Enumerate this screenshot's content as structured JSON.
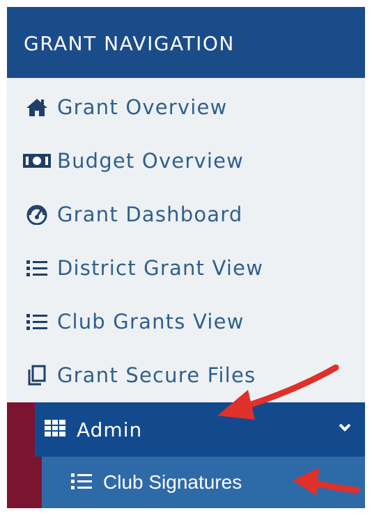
{
  "header": {
    "title": "GRANT NAVIGATION"
  },
  "nav": {
    "items": [
      {
        "label": "Grant Overview",
        "icon": "home-icon"
      },
      {
        "label": "Budget Overview",
        "icon": "money-icon"
      },
      {
        "label": "Grant Dashboard",
        "icon": "dashboard-icon"
      },
      {
        "label": "District Grant View",
        "icon": "list-icon"
      },
      {
        "label": "Club Grants View",
        "icon": "list-icon"
      },
      {
        "label": "Grant Secure Files",
        "icon": "copy-icon"
      }
    ],
    "admin": {
      "label": "Admin",
      "icon": "grid-icon",
      "expanded": true
    },
    "sub_items": [
      {
        "label": "Club Signatures",
        "icon": "list-icon"
      }
    ]
  },
  "colors": {
    "header_bg": "#1b4c8a",
    "panel_bg": "#eef1f4",
    "link_text": "#2f5f8f",
    "admin_bg": "#134a8e",
    "sub_bg": "#2f6aa8",
    "accent_bar": "#7b1430",
    "annotation_arrow": "#e0302a"
  }
}
